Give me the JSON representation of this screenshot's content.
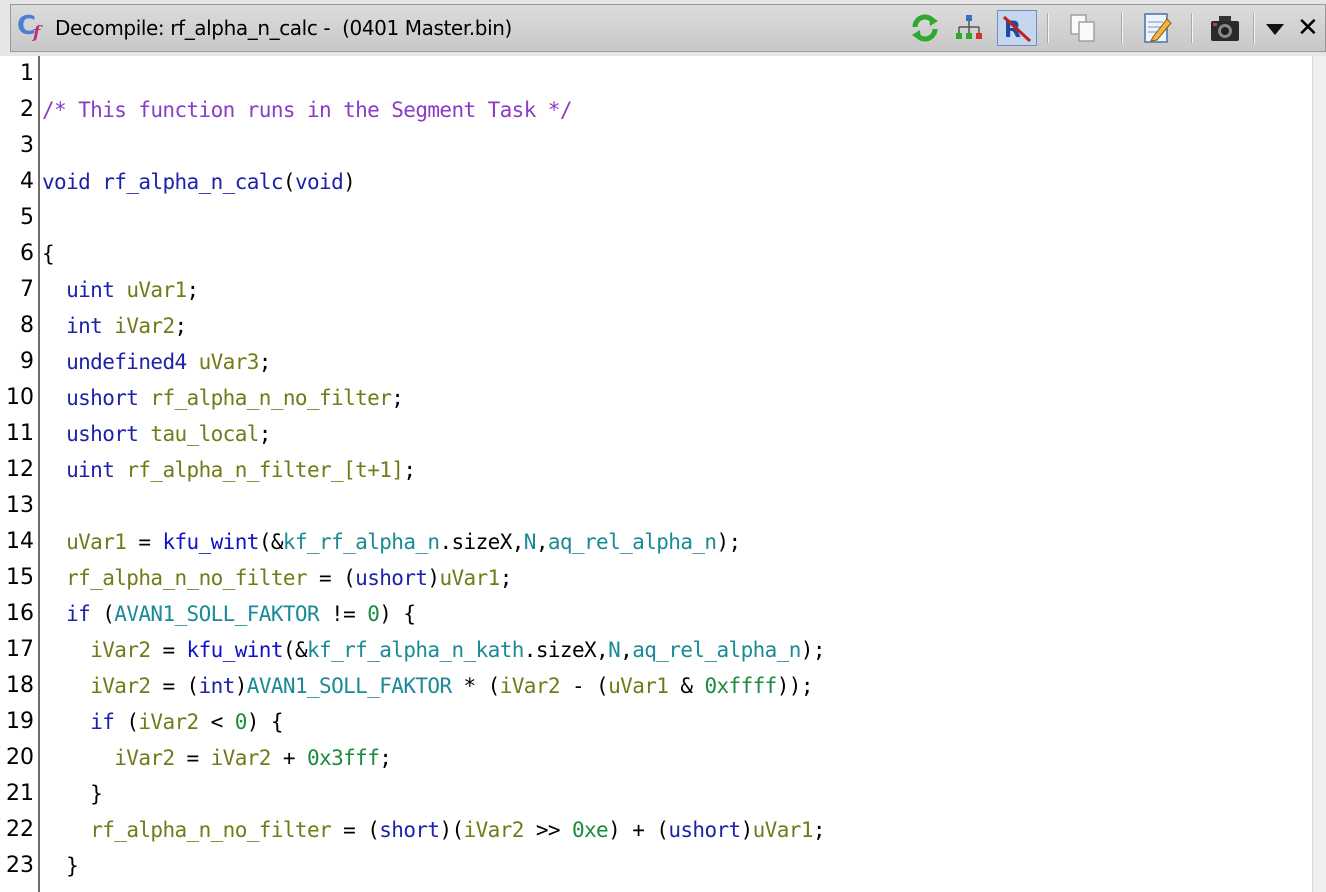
{
  "window": {
    "title": "Decompile: rf_alpha_n_calc -  (0401 Master.bin)"
  },
  "toolbar": {
    "icons": [
      "refresh-icon",
      "graph-icon",
      "toggle-highlight-icon",
      "copy-icon",
      "edit-icon",
      "snapshot-icon",
      "menu-dropdown-icon",
      "close-icon"
    ],
    "close_glyph": "✕"
  },
  "line_numbers": [
    "1",
    "2",
    "3",
    "4",
    "5",
    "6",
    "7",
    "8",
    "9",
    "10",
    "11",
    "12",
    "13",
    "14",
    "15",
    "16",
    "17",
    "18",
    "19",
    "20",
    "21",
    "22",
    "23"
  ],
  "code": {
    "l2_comment": "/* This function runs in the Segment Task */",
    "l4_type": "void",
    "l4_name": "rf_alpha_n_calc",
    "l4_params": "void",
    "l7_type": "uint",
    "l7_var": "uVar1",
    "l8_type": "int",
    "l8_var": "iVar2",
    "l9_type": "undefined4",
    "l9_var": "uVar3",
    "l10_type": "ushort",
    "l10_var": "rf_alpha_n_no_filter",
    "l11_type": "ushort",
    "l11_var": "tau_local",
    "l12_type": "uint",
    "l12_var": "rf_alpha_n_filter_[t+1]",
    "kfu_wint": "kfu_wint",
    "kf_rf_alpha_n": "kf_rf_alpha_n",
    "kf_rf_alpha_n_kath": "kf_rf_alpha_n_kath",
    "sizeX": "sizeX",
    "N": "N",
    "aq_rel_alpha_n": "aq_rel_alpha_n",
    "avan1": "AVAN1_SOLL_FAKTOR",
    "if_kw": "if",
    "zero": "0",
    "hex_ffff": "0xffff",
    "hex_3fff": "0x3fff",
    "hex_e": "0xe",
    "cast_ushort": "ushort",
    "cast_int": "int",
    "cast_short": "short"
  }
}
